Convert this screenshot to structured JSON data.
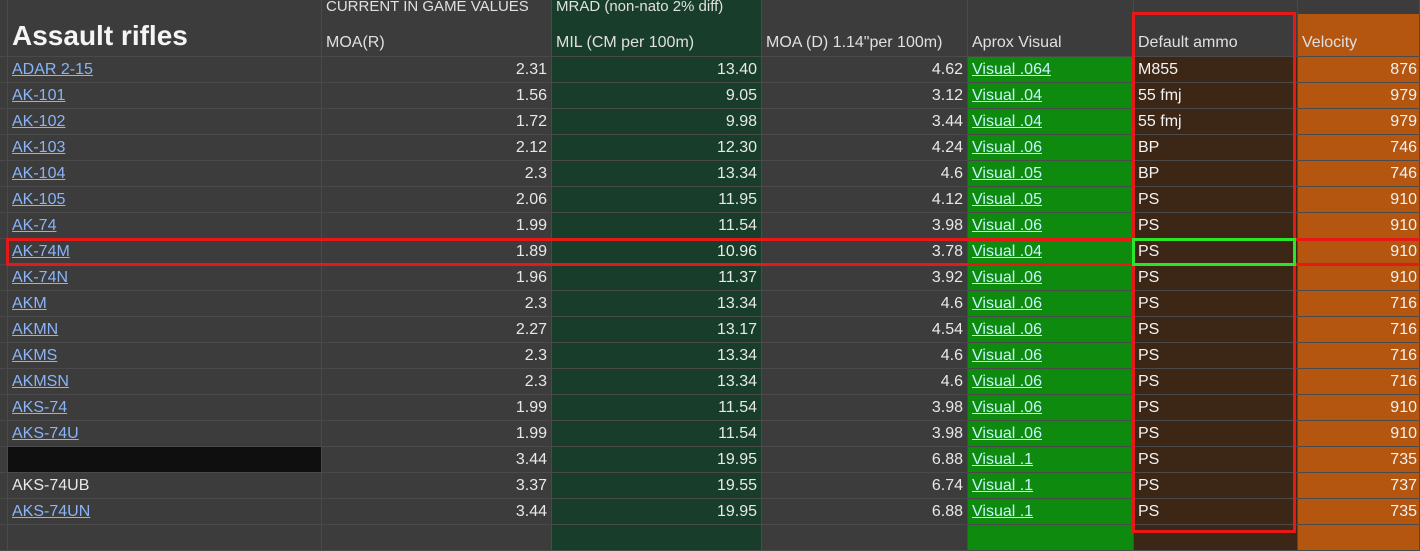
{
  "sheet": {
    "title": "Assault rifles",
    "header_top": {
      "moa_r": "CURRENT IN GAME VALUES",
      "mil": "MRAD (non-nato 2% diff)"
    },
    "headers": {
      "moa_r": "MOA(R)",
      "mil": "MIL (CM per 100m)",
      "moa_d": "MOA (D) 1.14\"per 100m)",
      "visual": "Aprox Visual",
      "ammo": "Default ammo",
      "velocity": "Velocity"
    },
    "rows": [
      {
        "name": "ADAR 2-15",
        "link": true,
        "moa_r": "2.31",
        "mil": "13.40",
        "moa_d": "4.62",
        "visual": "Visual .064",
        "ammo": "M855",
        "velocity": "876"
      },
      {
        "name": "AK-101",
        "link": true,
        "moa_r": "1.56",
        "mil": "9.05",
        "moa_d": "3.12",
        "visual": "Visual .04",
        "ammo": "55 fmj",
        "velocity": "979"
      },
      {
        "name": "AK-102",
        "link": true,
        "moa_r": "1.72",
        "mil": "9.98",
        "moa_d": "3.44",
        "visual": "Visual .04",
        "ammo": "55 fmj",
        "velocity": "979"
      },
      {
        "name": "AK-103",
        "link": true,
        "moa_r": "2.12",
        "mil": "12.30",
        "moa_d": "4.24",
        "visual": "Visual .06",
        "ammo": "BP",
        "velocity": "746"
      },
      {
        "name": "AK-104",
        "link": true,
        "moa_r": "2.3",
        "mil": "13.34",
        "moa_d": "4.6",
        "visual": "Visual .05",
        "ammo": "BP",
        "velocity": "746"
      },
      {
        "name": "AK-105",
        "link": true,
        "moa_r": "2.06",
        "mil": "11.95",
        "moa_d": "4.12",
        "visual": "Visual .05",
        "ammo": "PS",
        "velocity": "910"
      },
      {
        "name": "AK-74",
        "link": true,
        "moa_r": "1.99",
        "mil": "11.54",
        "moa_d": "3.98",
        "visual": "Visual .06",
        "ammo": "PS",
        "velocity": "910"
      },
      {
        "name": "AK-74M",
        "link": true,
        "moa_r": "1.89",
        "mil": "10.96",
        "moa_d": "3.78",
        "visual": "Visual .04",
        "ammo": "PS",
        "velocity": "910",
        "selected": true
      },
      {
        "name": "AK-74N",
        "link": true,
        "moa_r": "1.96",
        "mil": "11.37",
        "moa_d": "3.92",
        "visual": "Visual .06",
        "ammo": "PS",
        "velocity": "910"
      },
      {
        "name": "AKM",
        "link": true,
        "moa_r": "2.3",
        "mil": "13.34",
        "moa_d": "4.6",
        "visual": "Visual .06",
        "ammo": "PS",
        "velocity": "716"
      },
      {
        "name": "AKMN",
        "link": true,
        "moa_r": "2.27",
        "mil": "13.17",
        "moa_d": "4.54",
        "visual": "Visual .06",
        "ammo": "PS",
        "velocity": "716"
      },
      {
        "name": "AKMS",
        "link": true,
        "moa_r": "2.3",
        "mil": "13.34",
        "moa_d": "4.6",
        "visual": "Visual .06",
        "ammo": "PS",
        "velocity": "716"
      },
      {
        "name": "AKMSN",
        "link": true,
        "moa_r": "2.3",
        "mil": "13.34",
        "moa_d": "4.6",
        "visual": "Visual .06",
        "ammo": "PS",
        "velocity": "716"
      },
      {
        "name": "AKS-74",
        "link": true,
        "moa_r": "1.99",
        "mil": "11.54",
        "moa_d": "3.98",
        "visual": "Visual .06",
        "ammo": "PS",
        "velocity": "910"
      },
      {
        "name": "AKS-74U",
        "link": true,
        "moa_r": "1.99",
        "mil": "11.54",
        "moa_d": "3.98",
        "visual": "Visual .06",
        "ammo": "PS",
        "velocity": "910"
      },
      {
        "name": "",
        "link": false,
        "blank": true,
        "moa_r": "3.44",
        "mil": "19.95",
        "moa_d": "6.88",
        "visual": "Visual .1",
        "ammo": "PS",
        "velocity": "735"
      },
      {
        "name": "AKS-74UB",
        "link": false,
        "moa_r": "3.37",
        "mil": "19.55",
        "moa_d": "6.74",
        "visual": "Visual .1",
        "ammo": "PS",
        "velocity": "737"
      },
      {
        "name": "AKS-74UN",
        "link": true,
        "moa_r": "3.44",
        "mil": "19.95",
        "moa_d": "6.88",
        "visual": "Visual .1",
        "ammo": "PS",
        "velocity": "735"
      }
    ]
  },
  "colors": {
    "highlight_red": "#e61919",
    "highlight_green": "#29e629",
    "mil_column": "#183d2a",
    "visual_column": "#0e8b0e",
    "ammo_column": "#3c2615",
    "velocity_column": "#b4560f"
  }
}
